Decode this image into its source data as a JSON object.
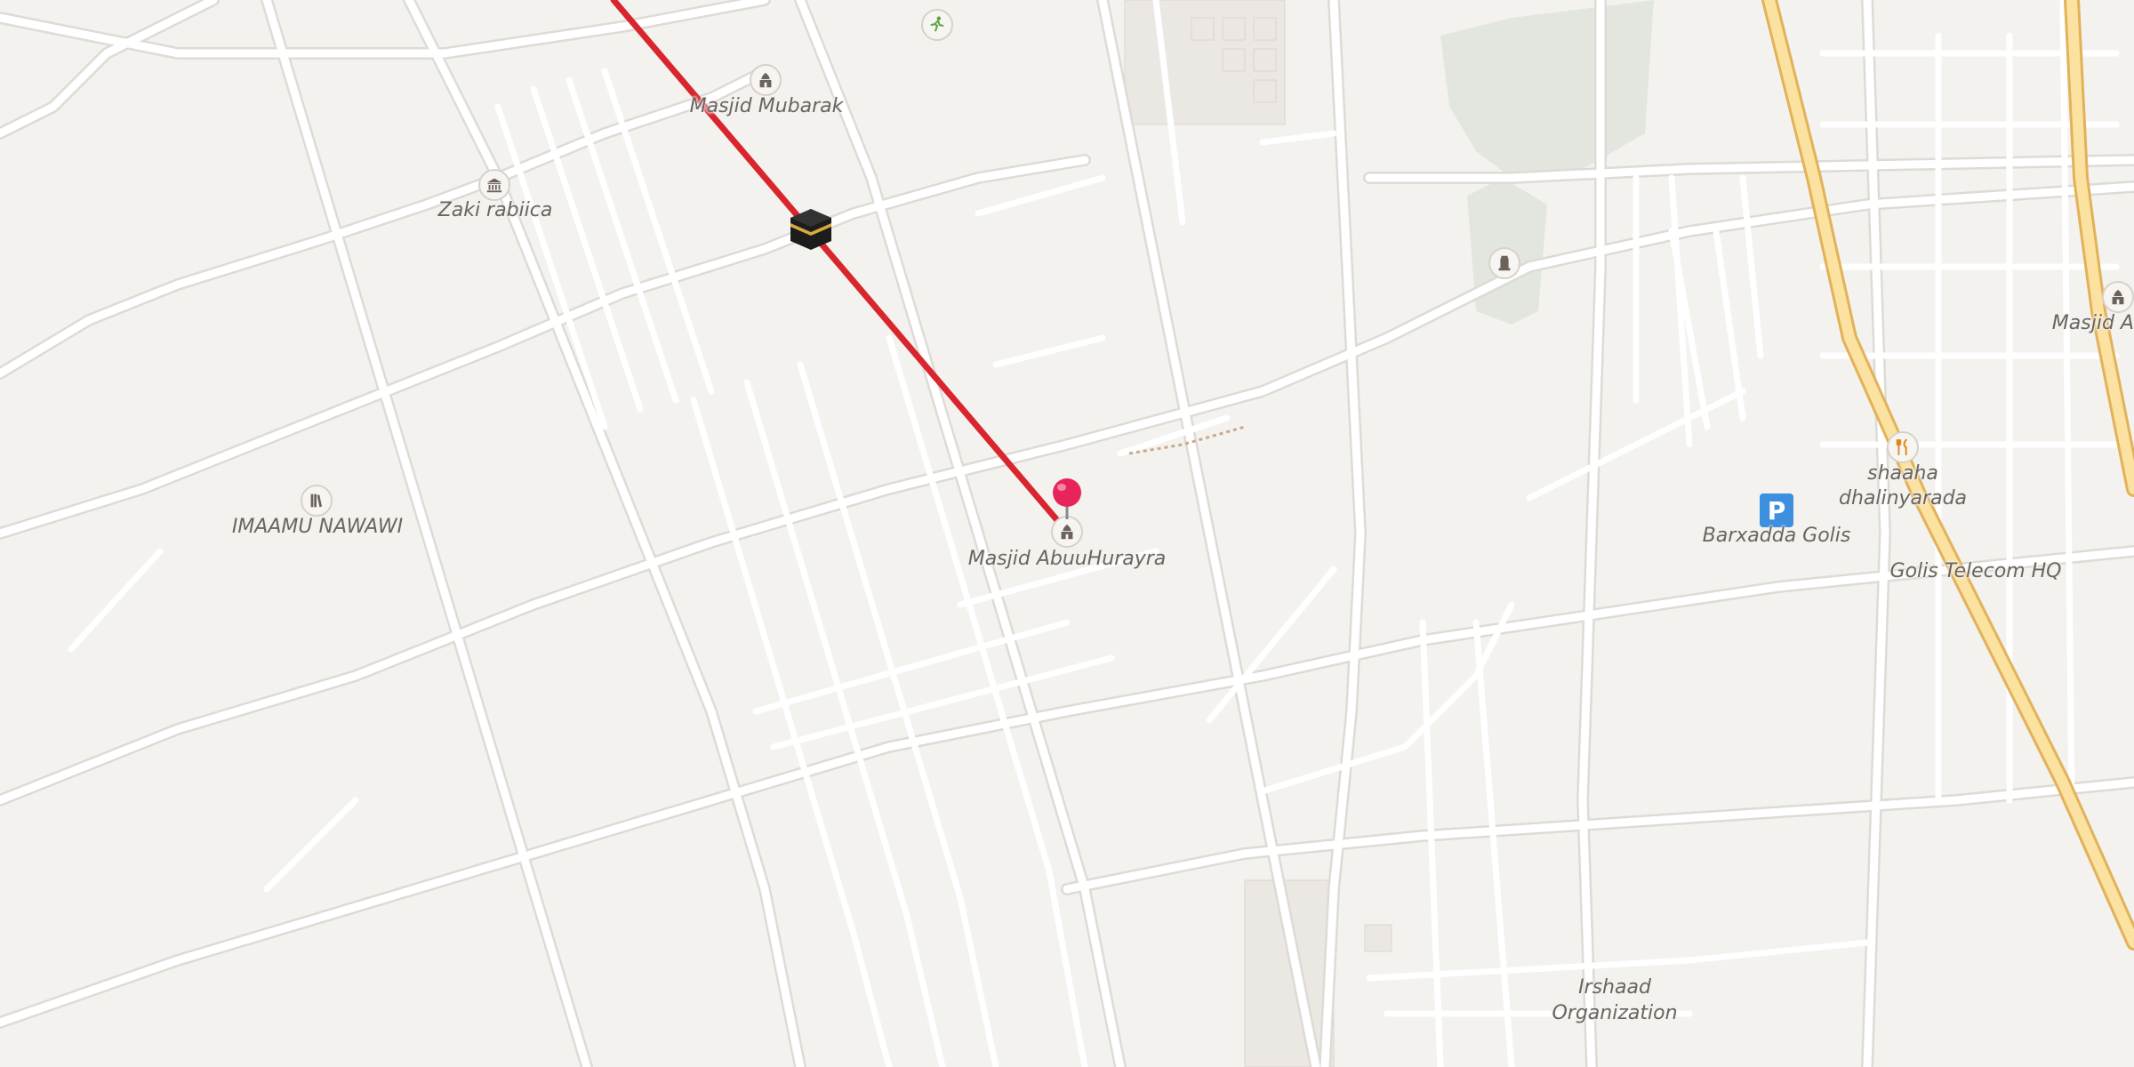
{
  "map": {
    "labels": {
      "masjid_mubarak": "Masjid Mubarak",
      "zaki_rabiica": "Zaki rabiica",
      "imaamu_nawawi": "IMAAMU NAWAWI",
      "masjid_abuuhurayra": "Masjid AbuuHurayra",
      "masjid_ali": "Masjid Ali",
      "shaaha_line1": "shaaha",
      "shaaha_line2": "dhalinyarada",
      "barxadda_golis": "Barxadda Golis",
      "golis_telecom": "Golis Telecom HQ",
      "irshaad_line1": "Irshaad",
      "irshaad_line2": "Organization",
      "parking": "P"
    },
    "route": {
      "color": "#d9262e"
    },
    "pin": {
      "color": "#e8245a"
    },
    "icons": {
      "sports": "running-person-icon",
      "mosque": "mosque-icon",
      "museum": "museum-icon",
      "library": "library-icon",
      "monument": "monument-icon",
      "restaurant": "fork-knife-icon",
      "qibla": "kaaba-icon",
      "parking": "parking-icon"
    }
  }
}
